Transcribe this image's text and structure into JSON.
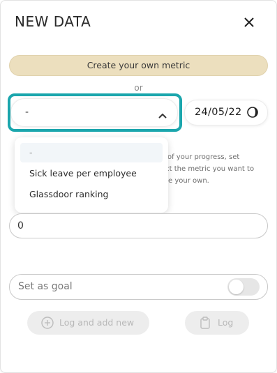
{
  "dialog": {
    "title": "NEW DATA",
    "close_icon": "close-icon"
  },
  "create_metric_button": {
    "label": "Create your own metric",
    "color": "#ecdfbe"
  },
  "or_separator": "or",
  "metric_select": {
    "value": "-",
    "icon": "chevron-up-icon",
    "highlight_color": "#1ba6ad"
  },
  "date": {
    "value": "24/05/22",
    "icon": "moon-icon"
  },
  "dropdown": {
    "options": [
      {
        "label": "-",
        "selected": true
      },
      {
        "label": "Sick leave per employee",
        "selected": false
      },
      {
        "label": "Glassdoor ranking",
        "selected": false
      }
    ]
  },
  "help_text": {
    "lines": [
      "k of your progress, set",
      "ect the metric you want to",
      "ate your own."
    ]
  },
  "value_input": {
    "value": "0"
  },
  "goal": {
    "label": "Set as goal",
    "enabled": false
  },
  "actions": {
    "log_and_add_new": {
      "label": "Log and add new",
      "icon": "plus-circle-icon"
    },
    "log": {
      "label": "Log",
      "icon": "clipboard-icon"
    }
  }
}
